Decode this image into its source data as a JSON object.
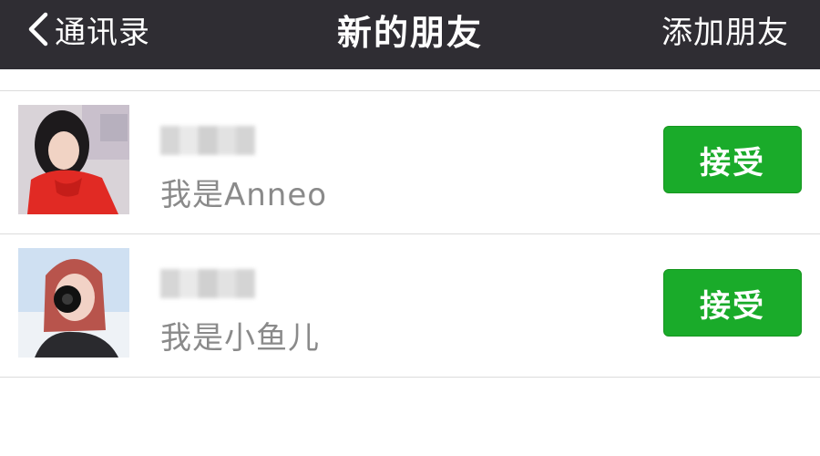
{
  "navbar": {
    "back_label": "通讯录",
    "title": "新的朋友",
    "action_label": "添加朋友",
    "icons": {
      "back": "chevron-left-icon"
    },
    "colors": {
      "background": "#2f2d33",
      "text": "#ffffff"
    }
  },
  "requests": [
    {
      "name": "",
      "message": "我是Anneo",
      "accept_label": "接受"
    },
    {
      "name": "",
      "message": "我是小鱼儿",
      "accept_label": "接受"
    }
  ],
  "colors": {
    "accent": "#1aab2a",
    "message_text": "#8a8a8a"
  }
}
